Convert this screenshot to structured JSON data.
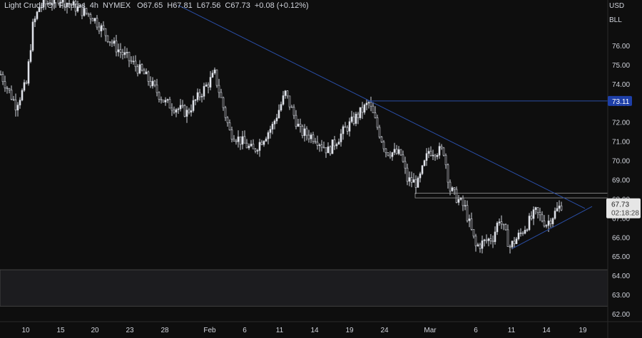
{
  "header": {
    "symbol": "Light Crude Oil Futures",
    "interval": "4h",
    "exchange": "NYMEX",
    "open": "O67.65",
    "high": "H67.81",
    "low": "L67.56",
    "close": "C67.73",
    "change": "+0.08 (+0.12%)"
  },
  "scale_buttons": {
    "currency": "USD",
    "unit": "BLL"
  },
  "chart_data": {
    "type": "candlestick",
    "title": "Light Crude Oil Futures · 4h · NYMEX",
    "ylim": [
      62,
      78.3
    ],
    "y_ticks": [
      "76.00",
      "75.00",
      "74.00",
      "73.00",
      "72.00",
      "71.00",
      "70.00",
      "69.00",
      "68.00",
      "67.00",
      "66.00",
      "65.00",
      "64.00",
      "63.00",
      "62.00"
    ],
    "x_ticks": [
      "10",
      "15",
      "20",
      "23",
      "28",
      "Feb",
      "6",
      "11",
      "14",
      "19",
      "24",
      "Mar",
      "6",
      "11",
      "14",
      "19"
    ],
    "price_path_waypoints": [
      [
        0,
        74.5
      ],
      [
        7,
        72.9
      ],
      [
        12,
        74
      ],
      [
        15,
        77
      ],
      [
        18,
        78
      ],
      [
        27,
        78.5
      ],
      [
        43,
        77.5
      ],
      [
        53,
        76
      ],
      [
        67,
        74.5
      ],
      [
        77,
        73
      ],
      [
        87,
        72.5
      ],
      [
        100,
        74.5
      ],
      [
        107,
        71.5
      ],
      [
        118,
        70.5
      ],
      [
        127,
        71.8
      ],
      [
        133,
        73.5
      ],
      [
        140,
        71.5
      ],
      [
        147,
        71.2
      ],
      [
        153,
        70.5
      ],
      [
        160,
        71.5
      ],
      [
        172,
        73
      ],
      [
        180,
        70.5
      ],
      [
        187,
        70.3
      ],
      [
        190,
        69
      ],
      [
        195,
        68.8
      ],
      [
        200,
        70.5
      ],
      [
        207,
        70.5
      ],
      [
        210,
        68.5
      ],
      [
        217,
        67.5
      ],
      [
        222,
        65.5
      ],
      [
        230,
        66
      ],
      [
        233,
        67
      ],
      [
        238,
        65.5
      ],
      [
        243,
        66.2
      ],
      [
        250,
        67.3
      ],
      [
        255,
        66.7
      ],
      [
        262,
        67.7
      ]
    ],
    "last_price": "67.73",
    "countdown": "02:18:28",
    "resistance_level": "73.11",
    "annotations": {
      "downtrend_line": [
        [
          83,
          78.1
        ],
        [
          273,
          67.5
        ]
      ],
      "support_trendline": [
        [
          239,
          65.4
        ],
        [
          275,
          67.6
        ]
      ],
      "resistance_zone": [
        68.05,
        68.3
      ],
      "demand_zone": [
        62.4,
        64.3
      ]
    },
    "colors": {
      "up": "#d1d4dc",
      "down": "#d1d4dc",
      "line": "#2a4ea6",
      "label": "#1e3fa8",
      "zone": "#1c1c1f"
    }
  }
}
